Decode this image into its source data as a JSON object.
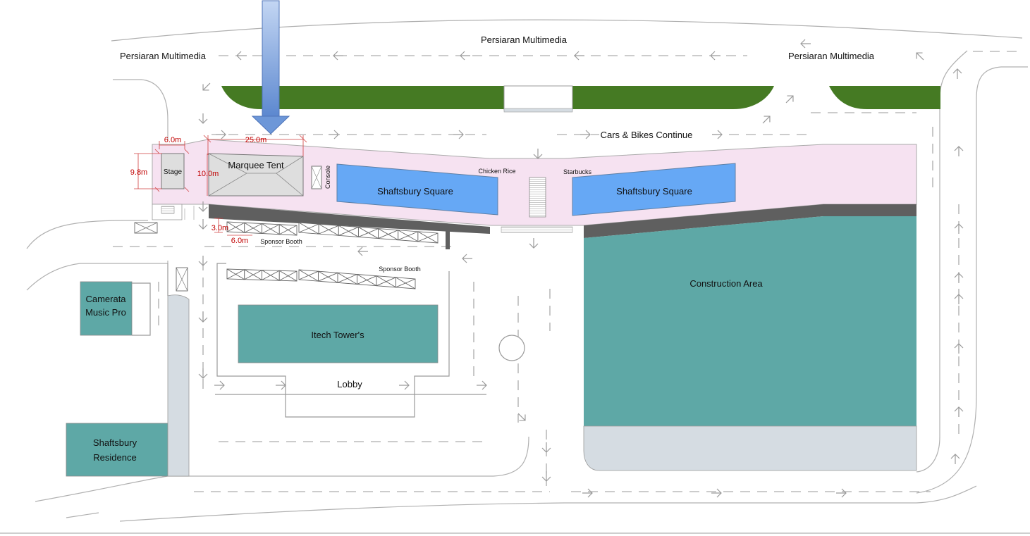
{
  "colors": {
    "event_zone": "#f6e2f1",
    "shop_blue": "#66a8f5",
    "building_teal": "#5ea8a6",
    "hedge_green": "#457a23",
    "walkway_grey": "#d5dce2",
    "wall_dark": "#5f5f5f",
    "tent_grey": "#dedede",
    "dimension_red": "#c00000",
    "indicator_blue": "#6d97d8"
  },
  "roads": {
    "top_center": "Persiaran Multimedia",
    "top_left": "Persiaran Multimedia",
    "top_right": "Persiaran Multimedia",
    "traffic_note": "Cars & Bikes Continue"
  },
  "event_area": {
    "stage": "Stage",
    "marquee_tent": "Marquee Tent",
    "console": "Console",
    "chicken_rice": "Chicken Rice",
    "starbucks": "Starbucks",
    "shop_left": "Shaftsbury Square",
    "shop_right": "Shaftsbury Square",
    "sponsor_booth_upper": "Sponsor Booth",
    "sponsor_booth_lower": "Sponsor Booth"
  },
  "dimensions": {
    "stage_width": "6.0m",
    "stage_depth": "9.8m",
    "tent_width": "25.0m",
    "tent_depth": "10.0m",
    "booth_depth": "3.0m",
    "booth_width": "6.0m"
  },
  "buildings": {
    "camerata": [
      "Camerata",
      "Music Pro"
    ],
    "itech": "Itech Tower's",
    "lobby": "Lobby",
    "construction": "Construction Area",
    "residence": [
      "Shaftsbury",
      "Residence"
    ]
  },
  "icons": {
    "indicator": "down-arrow-icon",
    "traffic": "traffic-arrow-icon",
    "booth": "booth-cross-icon",
    "roundabout": "circle-icon"
  }
}
